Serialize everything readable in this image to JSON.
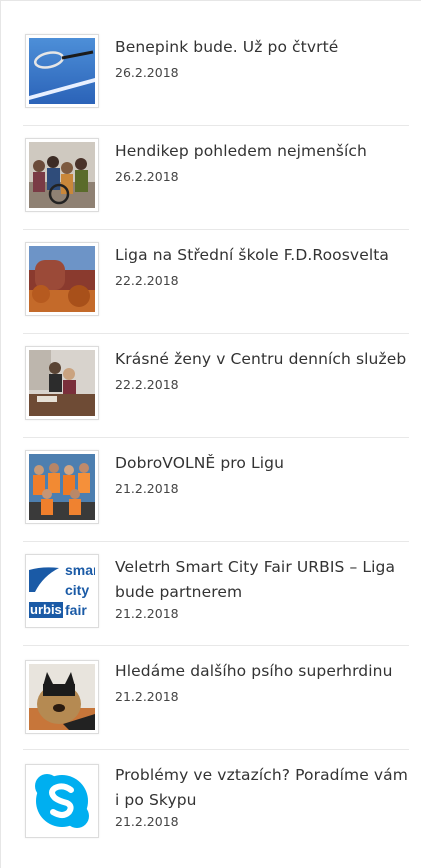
{
  "articles": [
    {
      "title": "Benepink bude. Už po čtvrté",
      "date": "26.2.2018",
      "thumbnail": "badminton-racket-photo"
    },
    {
      "title": "Hendikep pohledem nejmenších",
      "date": "26.2.2018",
      "thumbnail": "children-wheelchair-photo"
    },
    {
      "title": "Liga na Střední škole F.D.Roosvelta",
      "date": "22.2.2018",
      "thumbnail": "school-building-photo"
    },
    {
      "title": "Krásné ženy v Centru denních služeb",
      "date": "22.2.2018",
      "thumbnail": "women-meeting-photo"
    },
    {
      "title": "DobroVOLNĚ pro Ligu",
      "date": "21.2.2018",
      "thumbnail": "volunteers-group-photo"
    },
    {
      "title": "Veletrh Smart City Fair URBIS – Liga bude partnerem",
      "date": "21.2.2018",
      "thumbnail": "smart-city-fair-logo",
      "logo_text": [
        "smart",
        "city",
        "urbis",
        "fair"
      ]
    },
    {
      "title": "Hledáme dalšího psího superhrdinu",
      "date": "21.2.2018",
      "thumbnail": "dog-batman-photo"
    },
    {
      "title": "Problémy ve vztazích? Poradíme vám i po Skypu",
      "date": "21.2.2018",
      "thumbnail": "skype-logo"
    }
  ],
  "colors": {
    "text": "#333333",
    "date": "#444444",
    "divider": "#e8e8e8",
    "skype": "#00aff0",
    "urbis_blue": "#1a5aa6"
  }
}
